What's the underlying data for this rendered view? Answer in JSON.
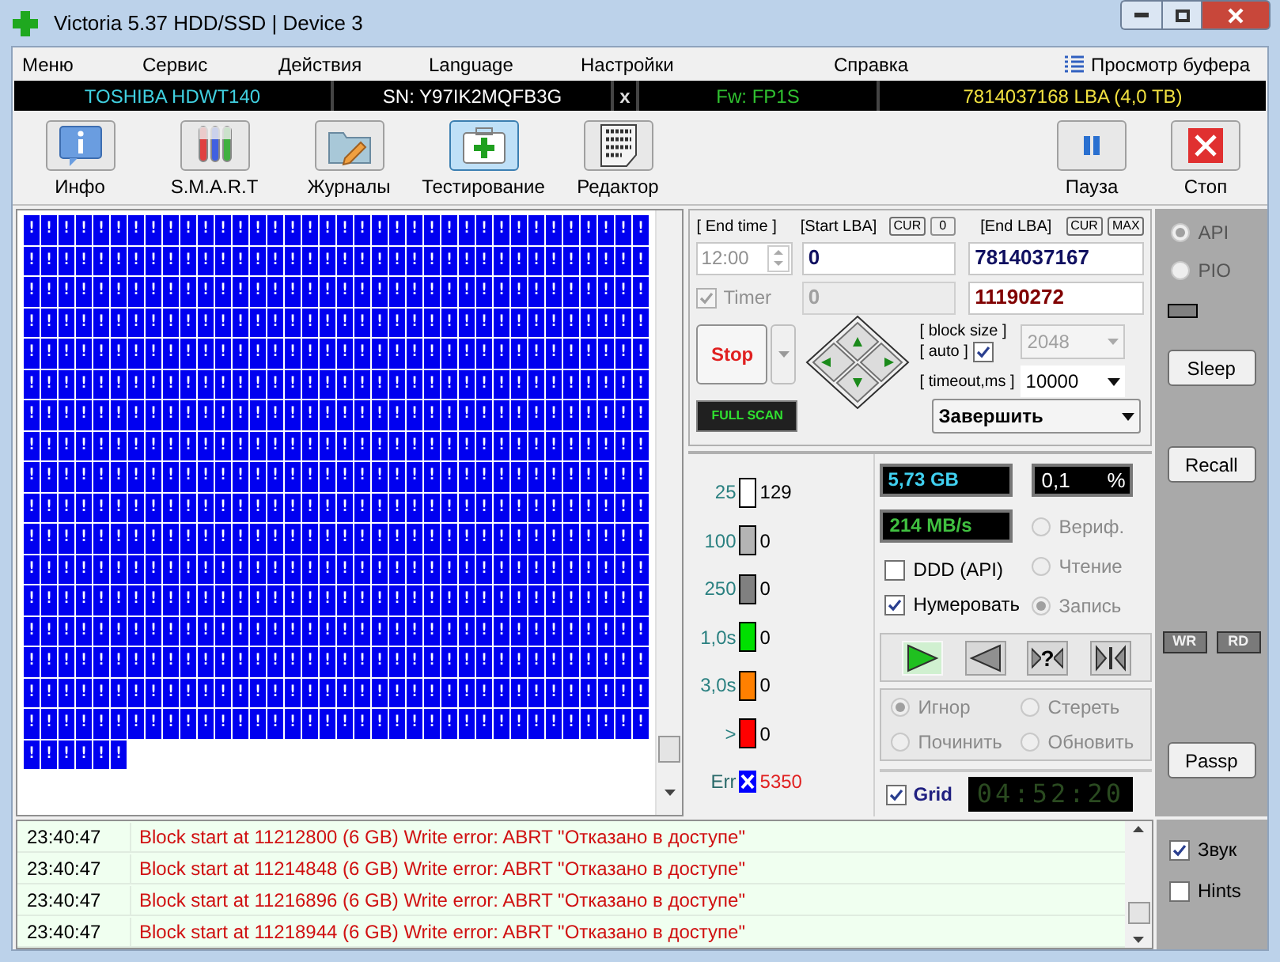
{
  "window": {
    "title": "Victoria 5.37 HDD/SSD | Device 3"
  },
  "menu": [
    {
      "label": "Меню",
      "kind": "plain"
    },
    {
      "label": "Сервис",
      "kind": "plain"
    },
    {
      "label": "Действия",
      "kind": "plain"
    },
    {
      "label": "Language",
      "kind": "plain"
    },
    {
      "label": "Настройки",
      "kind": "plain"
    },
    {
      "label": "Справка",
      "kind": "plain"
    },
    {
      "label": "Просмотр буфера",
      "kind": "buffer"
    }
  ],
  "drive_bar": {
    "model": "TOSHIBA HDWT140",
    "serial": "SN: Y97IK2MQFB3G",
    "close": "x",
    "firmware": "Fw: FP1S",
    "capacity": "7814037168 LBA (4,0 TB)"
  },
  "toolbar": [
    {
      "label": "Инфо",
      "kind": "info",
      "selected": false
    },
    {
      "label": "S.M.A.R.T",
      "kind": "smart",
      "selected": false
    },
    {
      "label": "Журналы",
      "kind": "logs",
      "selected": false
    },
    {
      "label": "Тестирование",
      "kind": "test",
      "selected": true
    },
    {
      "label": "Редактор",
      "kind": "editor",
      "selected": false
    }
  ],
  "toolbar_right": [
    {
      "label": "Пауза",
      "kind": "pause"
    },
    {
      "label": "Стоп",
      "kind": "stop"
    }
  ],
  "scan_map": {
    "rows": [
      "!!!!!!!!!!!!!!!!!!!!!!!!!!!!!!!!!!!!",
      "!!!!!!!!!!!!!!!!!!!!!!!!!!!!!!!!!!!!",
      "!!!!!!!!!!!!!!!!!!!!!!!!!!!!!!!!!!!!",
      "!!!!!!!!!!!!!!!!!!!!!!!!!!!!!!!!!!!!",
      "!!!!!!!!!!!!!!!!!!!!!!!!!!!!!!!!!!!!",
      "!!!!!!!!!!!!!!!!!!!!!!!!!!!!!!!!!!!!",
      "!!!!!!!!!!!!!!!!!!!!!!!!!!!!!!!!!!!!",
      "!!!!!!!!!!!!!!!!!!!!!!!!!!!!!!!!!!!!",
      "!!!!!!!!!!!!!!!!!!!!!!!!!!!!!!!!!!!!",
      "!!!!!!!!!!!!!!!!!!!!!!!!!!!!!!!!!!!!",
      "!!!!!!!!!!!!!!!!!!!!!!!!!!!!!!!!!!!!",
      "!!!!!!!!!!!!!!!!!!!!!!!!!!!!!!!!!!!!",
      "!!!!!!!!!!!!!!!!!!!!!!!!!!!!!!!!!!!!",
      "!!!!!!!!!!!!!!!!!!!!!!!!!!!!!!!!!!!!",
      "!!!!!!!!!!!!!!!!!!!!!!!!!!!!!!!!!!!!",
      "!!!!!!!!!!!!!!!!!!!!!!!!!!!!!!!!!!!!",
      "!!!!!!!!!!!!!!!!!!!!!!!!!!!!!!!!!!!!",
      "!!!!!!"
    ]
  },
  "range": {
    "end_time_label": "[ End time ]",
    "start_label": "[Start LBA]",
    "start_cur": "CUR",
    "start_zero": "0",
    "end_label": "[End LBA]",
    "end_cur": "CUR",
    "end_max": "MAX",
    "end_time": "12:00",
    "start_lba": "0",
    "end_lba": "7814037167",
    "timer": {
      "label": "Timer",
      "checked": true,
      "disabled": true
    },
    "timer_value": "0",
    "current_lba": "11190272"
  },
  "run": {
    "stop": "Stop",
    "full_scan": "FULL SCAN",
    "block_size_label": "[ block size ]",
    "auto_label": "[ auto ]",
    "auto_checked": true,
    "block_size": "2048",
    "timeout_label": "[ timeout,ms ]",
    "timeout": "10000",
    "finish": "Завершить"
  },
  "legend": [
    {
      "label": "25",
      "count": "129",
      "color": "#ffffff",
      "kind": "bar"
    },
    {
      "label": "100",
      "count": "0",
      "color": "#b4b4b4",
      "kind": "bar"
    },
    {
      "label": "250",
      "count": "0",
      "color": "#808080",
      "kind": "bar"
    },
    {
      "label": "1,0s",
      "count": "0",
      "color": "#00e000",
      "kind": "bar"
    },
    {
      "label": "3,0s",
      "count": "0",
      "color": "#ff8000",
      "kind": "bar"
    },
    {
      "label": ">",
      "count": "0",
      "color": "#ff0000",
      "kind": "bar"
    },
    {
      "label": "Err",
      "count": "5350",
      "color": "#0000ff",
      "kind": "error"
    }
  ],
  "stats": {
    "size": "5,73 GB",
    "percent": "0,1",
    "percent_sign": "%",
    "speed": "214 MB/s"
  },
  "mode": {
    "disabled": true,
    "items": [
      {
        "label": "Вериф.",
        "selected": false
      },
      {
        "label": "Чтение",
        "selected": false
      },
      {
        "label": "Запись",
        "selected": true
      }
    ]
  },
  "options": [
    {
      "label": "DDD (API)",
      "checked": false
    },
    {
      "label": "Нумеровать",
      "checked": true
    }
  ],
  "direction": [
    {
      "kind": "forward",
      "selected": true
    },
    {
      "kind": "backward",
      "selected": false
    },
    {
      "kind": "verify",
      "mark": "?",
      "selected": false
    },
    {
      "kind": "butterfly",
      "selected": false
    }
  ],
  "action": {
    "disabled": true,
    "items": [
      {
        "label": "Игнор",
        "selected": true
      },
      {
        "label": "Стереть",
        "selected": false
      },
      {
        "label": "Починить",
        "selected": false
      },
      {
        "label": "Обновить",
        "selected": false
      }
    ]
  },
  "grid_toggle": {
    "label": "Grid",
    "checked": true
  },
  "clock": "04:52:20",
  "interface": [
    {
      "label": "API",
      "selected": true
    },
    {
      "label": "PIO",
      "selected": false
    }
  ],
  "side": {
    "sleep": "Sleep",
    "recall": "Recall",
    "wr": "WR",
    "rd": "RD",
    "passp": "Passp"
  },
  "log": [
    {
      "time": "23:40:47",
      "message": "Block start at 11212800 (6 GB) Write error: ABRT \"Отказано в доступе\""
    },
    {
      "time": "23:40:47",
      "message": "Block start at 11214848 (6 GB) Write error: ABRT \"Отказано в доступе\""
    },
    {
      "time": "23:40:47",
      "message": "Block start at 11216896 (6 GB) Write error: ABRT \"Отказано в доступе\""
    },
    {
      "time": "23:40:47",
      "message": "Block start at 11218944 (6 GB) Write error: ABRT \"Отказано в доступе\""
    }
  ],
  "log_options": [
    {
      "label": "Звук",
      "checked": true
    },
    {
      "label": "Hints",
      "checked": false
    }
  ]
}
